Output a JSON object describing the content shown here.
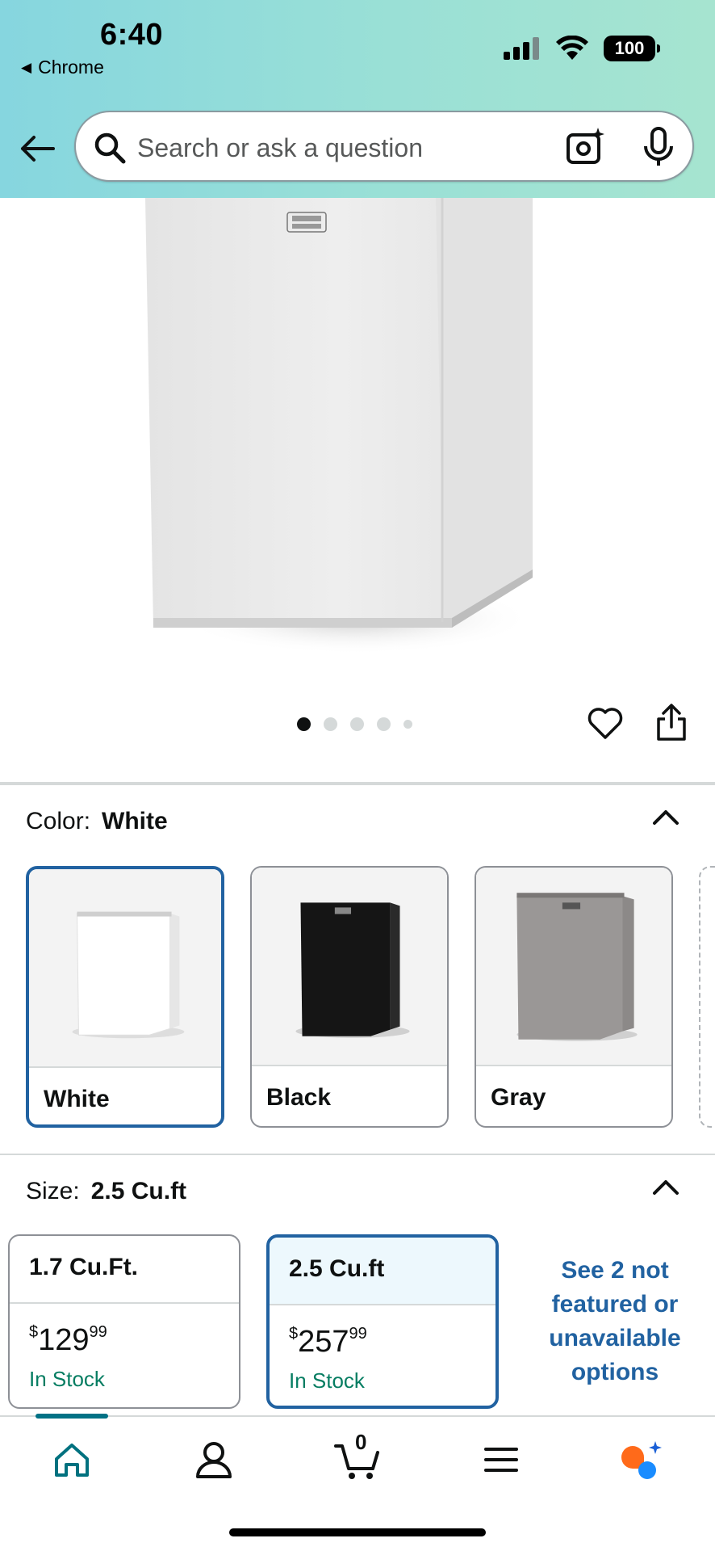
{
  "status_bar": {
    "time": "6:40",
    "back_app": "Chrome",
    "battery": "100"
  },
  "search": {
    "placeholder": "Search or ask a question"
  },
  "color_section": {
    "label": "Color:",
    "value": "White",
    "options": [
      {
        "name": "White",
        "selected": true
      },
      {
        "name": "Black",
        "selected": false
      },
      {
        "name": "Gray",
        "selected": false
      }
    ]
  },
  "size_section": {
    "label": "Size:",
    "value": "2.5 Cu.ft",
    "options": [
      {
        "name": "1.7 Cu.Ft.",
        "price_symbol": "$",
        "price_whole": "129",
        "price_fraction": "99",
        "stock": "In Stock",
        "selected": false
      },
      {
        "name": "2.5 Cu.ft",
        "price_symbol": "$",
        "price_whole": "257",
        "price_fraction": "99",
        "stock": "In Stock",
        "selected": true
      }
    ],
    "see_more": "See 2 not featured or unavailable options"
  },
  "carousel": {
    "count": 5,
    "active_index": 0
  },
  "bottom_nav": {
    "cart_count": "0",
    "items": [
      "home-icon",
      "account-icon",
      "cart-icon",
      "menu-icon",
      "rufus-icon"
    ]
  },
  "colors": {
    "accent_blue": "#2162a1",
    "in_stock_green": "#067d62",
    "teal": "#007185"
  }
}
